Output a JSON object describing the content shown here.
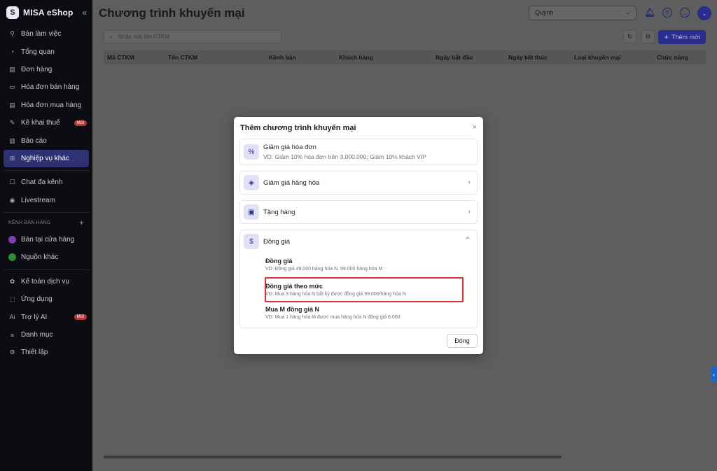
{
  "sidebar": {
    "brand": "MISA eShop",
    "collapse_icon": "«",
    "items": [
      {
        "label": "Bàn làm việc",
        "icon": "desk-icon"
      },
      {
        "label": "Tổng quan",
        "icon": "gauge-icon"
      },
      {
        "label": "Đơn hàng",
        "icon": "order-icon"
      },
      {
        "label": "Hóa đơn bán hàng",
        "icon": "invoice-icon"
      },
      {
        "label": "Hóa đơn mua hàng",
        "icon": "purchase-invoice-icon"
      },
      {
        "label": "Kê khai thuế",
        "icon": "tax-icon",
        "badge": "Mới"
      },
      {
        "label": "Báo cáo",
        "icon": "report-icon"
      },
      {
        "label": "Nghiệp vụ khác",
        "icon": "operations-icon",
        "active": true
      }
    ],
    "items2": [
      {
        "label": "Chat đa kênh",
        "icon": "chat-icon"
      },
      {
        "label": "Livestream",
        "icon": "livestream-icon"
      }
    ],
    "channel_section": {
      "title": "KÊNH BÁN HÀNG",
      "add": "+"
    },
    "channels": [
      {
        "label": "Bán tại cửa hàng",
        "color": "#7a3fb0"
      },
      {
        "label": "Nguồn khác",
        "color": "#2e8b3a"
      }
    ],
    "items3": [
      {
        "label": "Kế toán dịch vụ",
        "icon": "accounting-icon"
      },
      {
        "label": "Ứng dụng",
        "icon": "apps-icon"
      },
      {
        "label": "Trợ lý AI",
        "icon": "ai-icon",
        "badge": "Mới"
      },
      {
        "label": "Danh mục",
        "icon": "list-icon"
      },
      {
        "label": "Thiết lập",
        "icon": "settings-icon"
      }
    ]
  },
  "header": {
    "title": "Chương trình khuyến mại",
    "user": "Quỳnh",
    "search_placeholder": "Nhập mã, tên CTKM",
    "add_label": "Thêm mới",
    "add_icon": "+"
  },
  "table": {
    "columns": [
      "Mã CTKM",
      "Tên CTKM",
      "Kênh bán",
      "Khách hàng",
      "Ngày bắt đầu",
      "Ngày kết thúc",
      "Loại khuyến mại",
      "Chức năng"
    ]
  },
  "modal": {
    "title": "Thêm chương trình khuyến mại",
    "close_icon": "×",
    "options": [
      {
        "title": "Giảm giá hóa đơn",
        "desc": "VD: Giảm 10% hóa đơn trên 3.000.000; Giảm 10% khách VIP",
        "icon": "invoice-discount-icon"
      },
      {
        "title": "Giảm giá hàng hóa",
        "icon": "tag-discount-icon"
      },
      {
        "title": "Tặng hàng",
        "icon": "gift-icon"
      },
      {
        "title": "Đồng giá",
        "icon": "same-price-icon",
        "expanded": true,
        "sub": [
          {
            "title": "Đồng giá",
            "desc": "VD: Đồng giá 49.000 hàng hóa N, 99.000 hàng hóa M"
          },
          {
            "title": "Đồng giá theo mức",
            "desc": "VD: Mua 3 hàng hóa N bất kỳ được đồng giá 99.000/hàng hóa N",
            "highlighted": true
          },
          {
            "title": "Mua M đồng giá N",
            "desc": "VD: Mua 1 hàng hóa M được mua hàng hóa N đồng giá 6.000"
          }
        ]
      }
    ],
    "close_button": "Đóng"
  },
  "colors": {
    "accent": "#2a2d8a",
    "highlight": "#d8333a",
    "badge": "#b23b3b"
  }
}
